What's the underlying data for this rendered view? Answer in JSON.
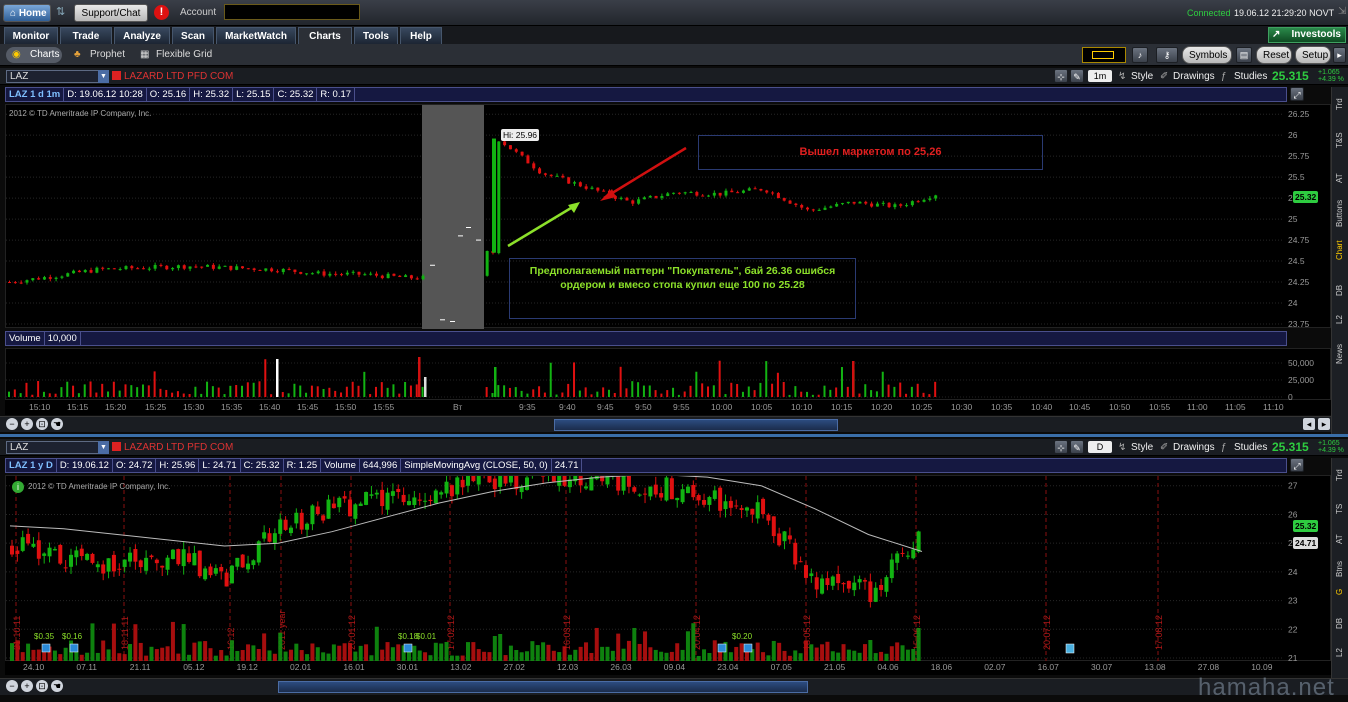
{
  "topbar": {
    "home": "Home",
    "support": "Support/Chat",
    "alert": "!",
    "account": "Account",
    "status": "Connected",
    "datetime": "19.06.12 21:29:20 NOVT"
  },
  "tabs": [
    {
      "label": "Monitor",
      "active": false
    },
    {
      "label": "Trade",
      "active": false
    },
    {
      "label": "Analyze",
      "active": false
    },
    {
      "label": "Scan",
      "active": false
    },
    {
      "label": "MarketWatch",
      "active": false
    },
    {
      "label": "Charts",
      "active": true
    },
    {
      "label": "Tools",
      "active": false
    },
    {
      "label": "Help",
      "active": false
    }
  ],
  "investools": "Investools",
  "subbar": {
    "charts": "Charts",
    "prophet": "Prophet",
    "flexgrid": "Flexible Grid",
    "symbols": "Symbols",
    "reset": "Reset",
    "setup": "Setup"
  },
  "chart1": {
    "symbol": "LAZ",
    "company": "LAZARD LTD PFD COM",
    "period": "1m",
    "style": "Style",
    "drawings": "Drawings",
    "studies": "Studies",
    "last": "25.315",
    "chg1": "+1.065",
    "chg2": "+4.39 %",
    "info": {
      "tag": "LAZ 1 d 1m",
      "d": "D: 19.06.12 10:28",
      "o": "O: 25.16",
      "h": "H: 25.32",
      "l": "L: 25.15",
      "c": "C: 25.32",
      "r": "R: 0.17"
    },
    "copyright": "2012 © TD Ameritrade IP Company, Inc.",
    "hi_tag": "Hi: 25.96",
    "price_tag": "25.32",
    "ann_red": "Вышел маркетом по 25,26",
    "ann_green": "Предполагаемый паттерн \"Покупатель\", бай 26.36 ошибся ордером и вмесо стопа купил еще 100 по 25.28",
    "yaxis": [
      "26.25",
      "26",
      "25.75",
      "25.5",
      "25.25",
      "25",
      "24.75",
      "24.5",
      "24.25",
      "24",
      "23.75"
    ],
    "volume_label": "Volume",
    "volume_value": "10,000",
    "vol_axis": [
      "50,000",
      "25,000",
      "0"
    ],
    "xaxis": [
      "15:10",
      "15:15",
      "15:20",
      "15:25",
      "15:30",
      "15:35",
      "15:40",
      "15:45",
      "15:50",
      "15:55",
      "Вт",
      "9:35",
      "9:40",
      "9:45",
      "9:50",
      "9:55",
      "10:00",
      "10:05",
      "10:10",
      "10:15",
      "10:20",
      "10:25",
      "10:30",
      "10:35",
      "10:40",
      "10:45",
      "10:50",
      "10:55",
      "11:00",
      "11:05",
      "11:10"
    ]
  },
  "chart2": {
    "symbol": "LAZ",
    "company": "LAZARD LTD PFD COM",
    "period": "D",
    "style": "Style",
    "drawings": "Drawings",
    "studies": "Studies",
    "last": "25.315",
    "chg1": "+1.065",
    "chg2": "+4.39 %",
    "info": {
      "tag": "LAZ 1 y D",
      "d": "D: 19.06.12",
      "o": "O: 24.72",
      "h": "H: 25.96",
      "l": "L: 24.71",
      "c": "C: 25.32",
      "r": "R: 1.25",
      "vol": "Volume",
      "volv": "644,996",
      "sma": "SimpleMovingAvg (CLOSE, 50, 0)",
      "smav": "24.71"
    },
    "copyright": "2012 © TD Ameritrade IP Company, Inc.",
    "price_tag": "25.32",
    "sma_tag": "24.71",
    "yaxis": [
      "27",
      "26",
      "25",
      "24",
      "23",
      "22",
      "21"
    ],
    "xaxis": [
      "24.10",
      "07.11",
      "21.11",
      "05.12",
      "19.12",
      "02.01",
      "16.01",
      "30.01",
      "13.02",
      "27.02",
      "12.03",
      "26.03",
      "09.04",
      "23.04",
      "07.05",
      "21.05",
      "04.06",
      "18.06",
      "02.07",
      "16.07",
      "30.07",
      "13.08",
      "27.08",
      "10.09"
    ],
    "dates": [
      "21.10.11",
      "18.11.11",
      "16.12",
      "2011 year",
      "20.01.12",
      "17.02.12",
      "16.03.12",
      "20.04.12",
      "18.05.12",
      "15.06.12",
      "20.07.12",
      "17.08.12"
    ],
    "divs": [
      "$0.35",
      "$0.16",
      "$0.01",
      "$0.18",
      "$0.20"
    ]
  },
  "right_tabs": [
    "Trd",
    "T&S",
    "AT",
    "Buttons",
    "Chart",
    "DB",
    "L2",
    "News"
  ],
  "right_tabs2": [
    "Trd",
    "TS",
    "AT",
    "Btns",
    "G",
    "DB",
    "L2"
  ],
  "watermark": "hamaha.net",
  "chart_data": [
    {
      "type": "candlestick",
      "title": "LAZ 1 d 1m",
      "ylim": [
        23.75,
        26.3
      ],
      "x": [
        "15:10",
        "15:15",
        "15:20",
        "15:25",
        "15:30",
        "15:35",
        "15:40",
        "15:45",
        "15:50",
        "15:55",
        "Вт",
        "9:35",
        "9:40",
        "9:45",
        "9:50",
        "9:55",
        "10:00",
        "10:05",
        "10:10",
        "10:15",
        "10:20",
        "10:25"
      ],
      "close": [
        24.25,
        24.32,
        24.4,
        24.42,
        24.44,
        24.42,
        24.4,
        24.35,
        24.34,
        24.3,
        24.3,
        25.96,
        25.55,
        25.38,
        25.2,
        25.32,
        25.3,
        25.36,
        25.1,
        25.2,
        25.15,
        25.32
      ],
      "high_mark": 25.96,
      "last": 25.32,
      "annotations": [
        "Вышел маркетом по 25,26",
        "Предполагаемый паттерн \"Покупатель\", бай 26.36 ошибся ордером и вмесо стопа купил еще 100 по 25.28"
      ]
    },
    {
      "type": "candlestick",
      "title": "LAZ 1 y D",
      "ylim": [
        21,
        27.2
      ],
      "x": [
        "24.10",
        "07.11",
        "21.11",
        "05.12",
        "19.12",
        "02.01",
        "16.01",
        "30.01",
        "13.02",
        "27.02",
        "12.03",
        "26.03",
        "09.04",
        "23.04",
        "07.05",
        "21.05",
        "04.06",
        "18.06"
      ],
      "close": [
        25.0,
        24.4,
        24.2,
        24.6,
        23.8,
        25.5,
        26.2,
        26.6,
        26.9,
        27.2,
        27.4,
        27.3,
        27.0,
        26.6,
        26.0,
        23.6,
        23.3,
        25.32
      ],
      "sma50": [
        25.6,
        25.5,
        25.3,
        25.1,
        24.9,
        25.0,
        25.4,
        25.9,
        26.4,
        26.8,
        27.1,
        27.3,
        27.4,
        27.3,
        27.0,
        26.2,
        25.3,
        24.71
      ],
      "last": 25.32
    }
  ]
}
